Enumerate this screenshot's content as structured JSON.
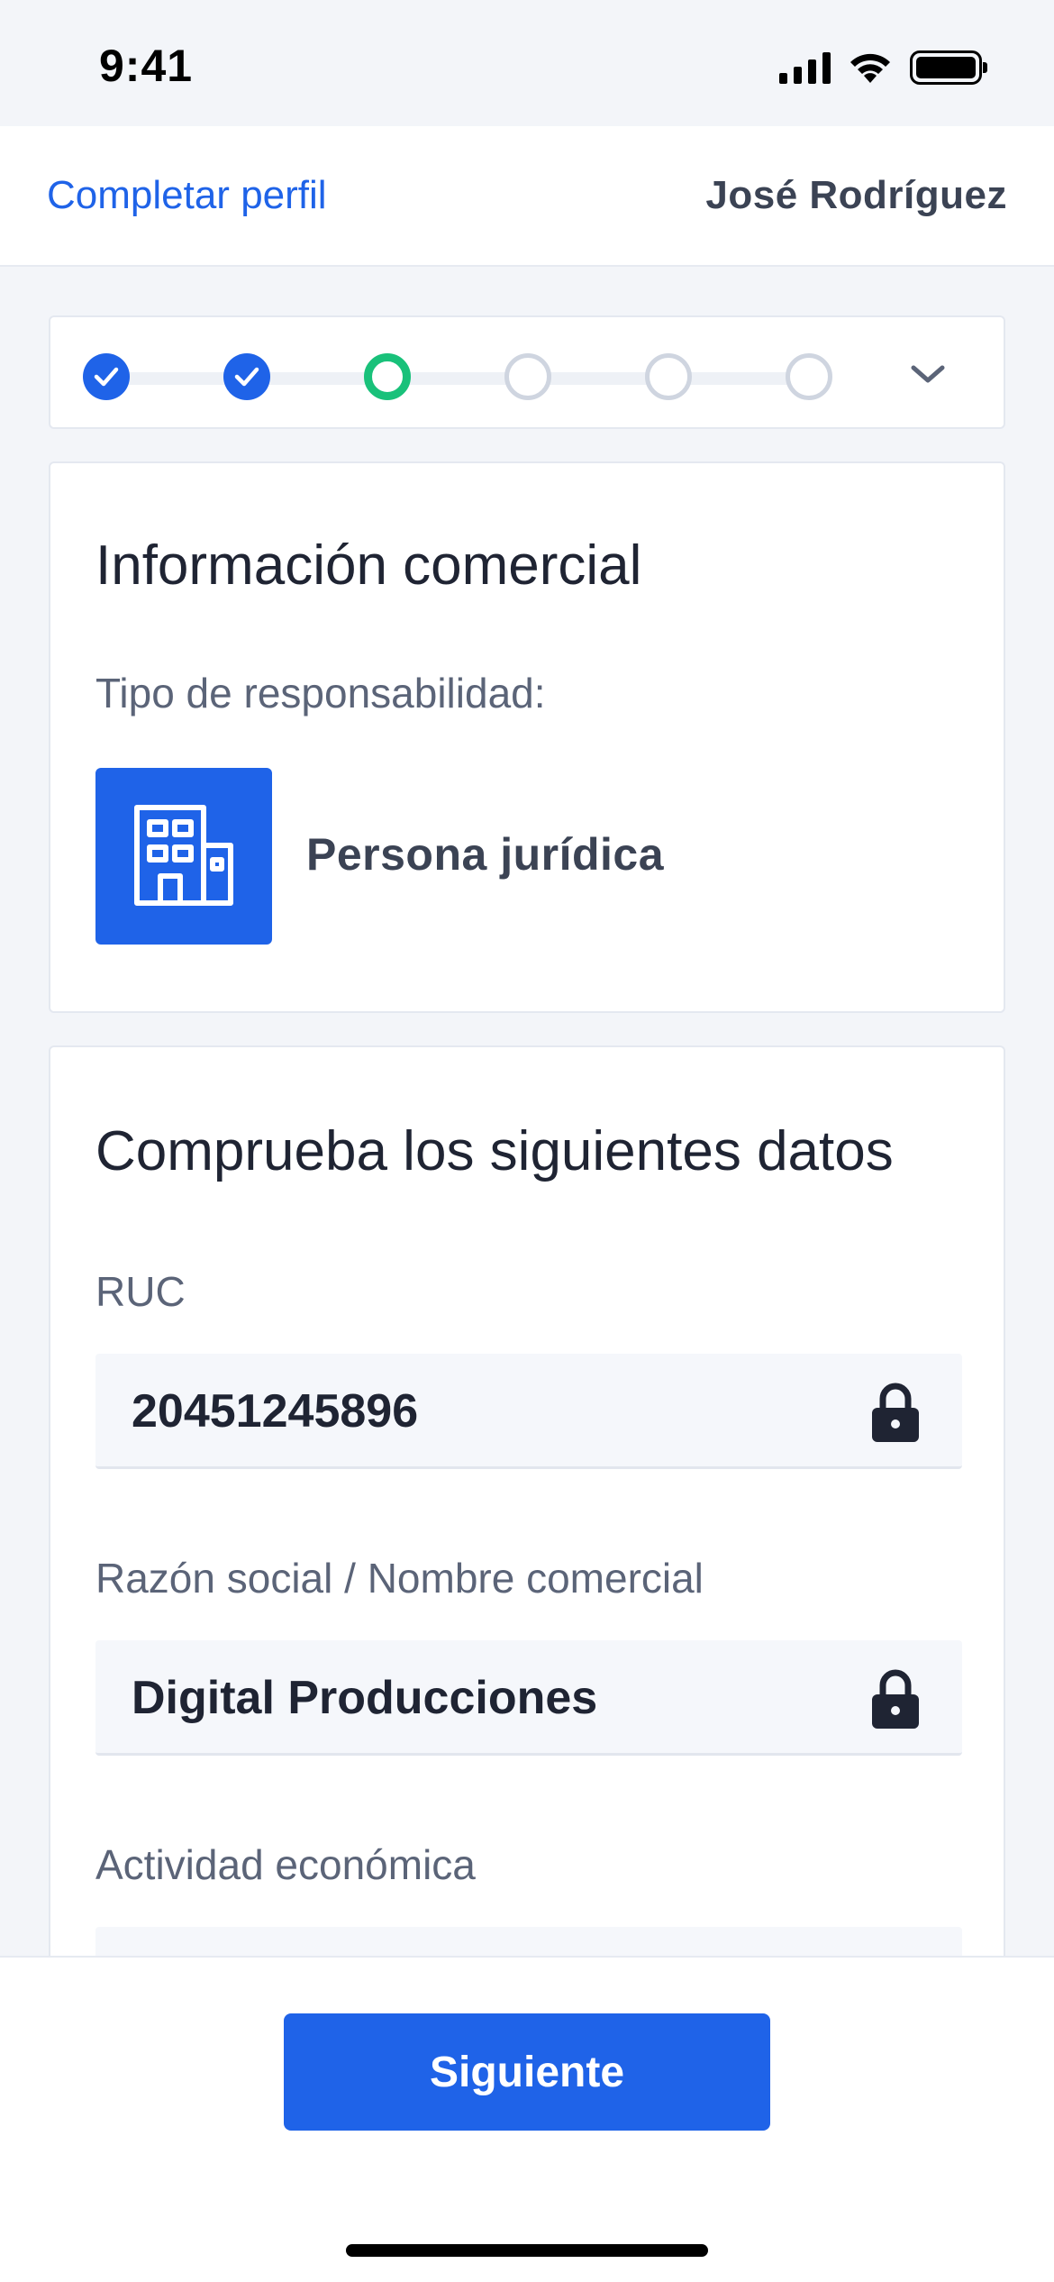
{
  "status_bar": {
    "time": "9:41"
  },
  "header": {
    "link_label": "Completar perfil",
    "user_name": "José Rodríguez"
  },
  "stepper": {
    "steps": [
      {
        "state": "completed"
      },
      {
        "state": "completed"
      },
      {
        "state": "current"
      },
      {
        "state": "pending"
      },
      {
        "state": "pending"
      },
      {
        "state": "pending"
      }
    ],
    "expand_icon": "chevron-down-icon"
  },
  "commercial_info": {
    "title": "Información comercial",
    "responsibility_label": "Tipo de responsabilidad:",
    "responsibility_value": "Persona jurídica",
    "responsibility_icon": "building-icon"
  },
  "verify_data": {
    "title": "Comprueba los siguientes datos",
    "ruc_label": "RUC",
    "ruc_value": "20451245896",
    "razon_label": "Razón social / Nombre comercial",
    "razon_value": "Digital Producciones",
    "actividad_label": "Actividad económica"
  },
  "footer": {
    "next_label": "Siguiente"
  },
  "colors": {
    "primary": "#1f63e8",
    "success": "#19c17a",
    "pending": "#cfd5e0"
  }
}
